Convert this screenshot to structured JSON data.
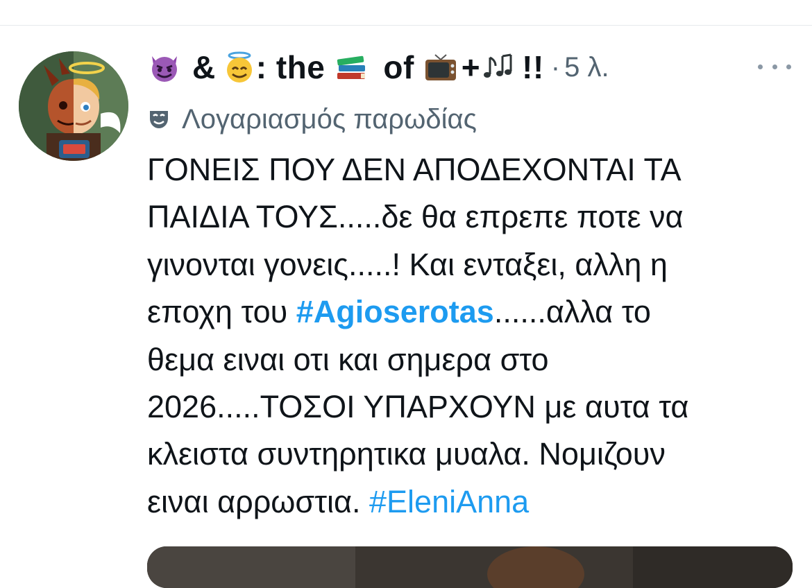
{
  "post": {
    "author": {
      "name_parts": [
        "&",
        ": the",
        "of",
        "+",
        "!!"
      ],
      "emoji_names": [
        "smiling-imp-icon",
        "smiling-halo-icon",
        "books-icon",
        "television-icon",
        "musical-notes-icon"
      ]
    },
    "separator": "·",
    "time_ago": "5 λ.",
    "parody_label": "Λογαριασμός παρωδίας",
    "body_lines": [
      [
        "ΓΟΝΕΙΣ ΠΟΥ ΔΕΝ ΑΠΟΔΕΧΟΝΤΑΙ ΤΑ"
      ],
      [
        "ΠΑΙΔΙΑ ΤΟΥΣ.....δε θα επρεπε ποτε να"
      ],
      [
        "γινονται γονεις.....! Και ενταξει, αλλη η"
      ],
      [
        "εποχη του ",
        "#Agioserotas",
        "......αλλα το"
      ],
      [
        "θεμα ειναι οτι και σημερα στο"
      ],
      [
        "2026.....ΤΟΣΟΙ ΥΠΑΡΧΟΥΝ με αυτα τα"
      ],
      [
        "κλειστα συντηρητικα μυαλα. Νομιζουν"
      ],
      [
        "ειναι αρρωστια. ",
        "#EleniAnna"
      ]
    ],
    "hashtags": [
      "#Agioserotas",
      "#EleniAnna"
    ]
  },
  "colors": {
    "text": "#0f1419",
    "secondary": "#536471",
    "link": "#1d9bf0"
  }
}
